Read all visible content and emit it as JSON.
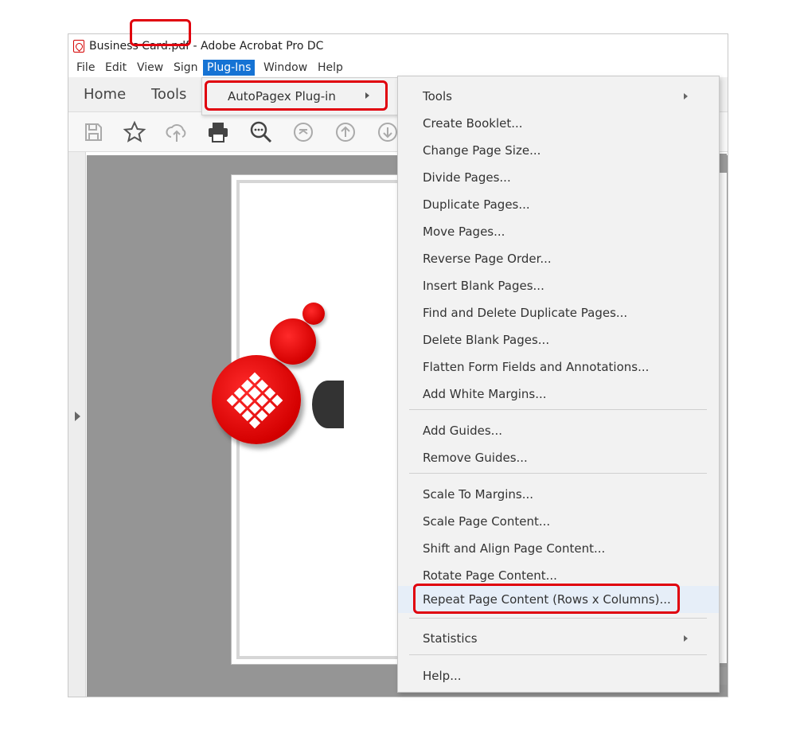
{
  "window": {
    "title": "Business Card.pdf - Adobe Acrobat Pro DC"
  },
  "menubar": {
    "file": "File",
    "edit": "Edit",
    "view": "View",
    "sign": "Sign",
    "plugins": "Plug-Ins",
    "window": "Window",
    "help": "Help"
  },
  "tabs": {
    "home": "Home",
    "tools": "Tools"
  },
  "submenu": {
    "autopagex": "AutoPagex Plug-in"
  },
  "dropdown": {
    "items": [
      "Tools",
      "Create Booklet...",
      "Change Page Size...",
      "Divide Pages...",
      "Duplicate Pages...",
      "Move Pages...",
      "Reverse Page Order...",
      "Insert Blank Pages...",
      "Find and Delete Duplicate Pages...",
      "Delete Blank Pages...",
      "Flatten Form Fields and Annotations...",
      "Add White Margins...",
      "Add Guides...",
      "Remove Guides...",
      "Scale To Margins...",
      "Scale Page Content...",
      "Shift and Align Page Content...",
      "Rotate Page Content...",
      "Repeat Page Content (Rows x Columns)...",
      "Statistics",
      "Help..."
    ]
  },
  "colors": {
    "highlight_red": "#e0000d",
    "menu_blue": "#1573d4",
    "logo_red": "#d40000"
  },
  "icons": [
    "save-icon",
    "star-icon",
    "cloud-upload-icon",
    "print-icon",
    "zoom-out-icon",
    "first-page-icon",
    "prev-page-icon",
    "next-page-icon"
  ]
}
